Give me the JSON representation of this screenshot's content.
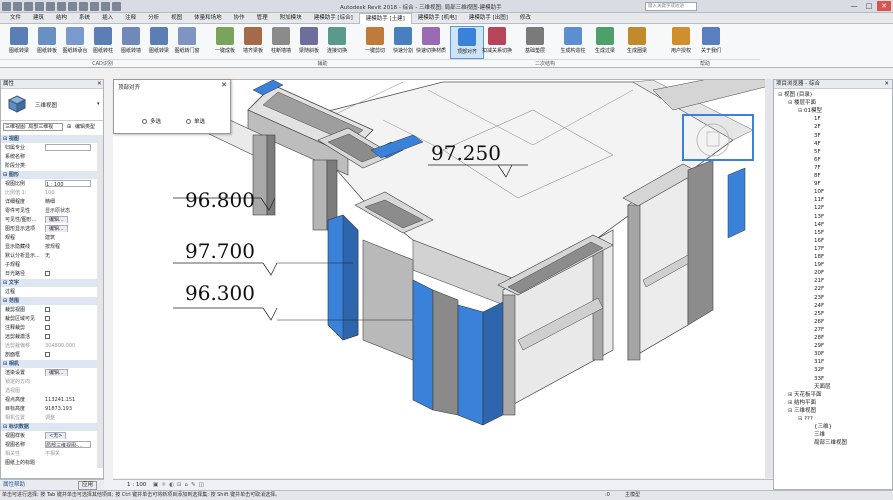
{
  "app": {
    "title": "Autodesk Revit 2018 -    综合 - 三维视图: 局部三维视图-建模助手",
    "search_placeholder": "键入关键字或短语",
    "min": "—",
    "max": "□",
    "close": "✕"
  },
  "menu_tabs": [
    "文件",
    "建筑",
    "结构",
    "系统",
    "插入",
    "注释",
    "分析",
    "视图",
    "体量和场地",
    "协作",
    "管理",
    "附加模块",
    "建模助手 [综合]",
    "建模助手 [土建]",
    "建模助手 [机电]",
    "建模助手 [出图]",
    "修改"
  ],
  "menu_active_index": 13,
  "ribbon": {
    "buttons": [
      "图纸转梁",
      "图纸转板",
      "图纸转承台",
      "图纸转柱",
      "图纸转墙",
      "图纸转梁",
      "图纸转门窗",
      "一键成板",
      "墙齐梁板",
      "柱断墙墙",
      "梁随斜板",
      "连接切换",
      "一键剪切",
      "快速分割",
      "快速切换材质",
      "顶部对齐",
      "扣减关系切换",
      "基础垫层",
      "生成构造柱",
      "生成过梁",
      "生成圈梁",
      "用户授权",
      "关于我们"
    ],
    "selected_index": 15,
    "groups": [
      "CAD识别",
      "辅助",
      "二次结构",
      "帮助"
    ]
  },
  "properties": {
    "header": "属性",
    "type_name": "三维视图",
    "view_selector": "三维视图: 局部三维视",
    "edit_type": "编辑类型",
    "rows": [
      {
        "k": "视图",
        "v": "",
        "kind": "section"
      },
      {
        "k": "归属专业",
        "v": "",
        "kind": "field"
      },
      {
        "k": "系统名称",
        "v": "",
        "kind": "text"
      },
      {
        "k": "阶段分类",
        "v": "",
        "kind": "text"
      },
      {
        "k": "图形",
        "v": "",
        "kind": "section"
      },
      {
        "k": "视图比例",
        "v": "1 : 100",
        "kind": "field"
      },
      {
        "k": "比例值 1:",
        "v": "100",
        "kind": "grey"
      },
      {
        "k": "详细程度",
        "v": "精细",
        "kind": "text"
      },
      {
        "k": "零件可见性",
        "v": "显示原状态",
        "kind": "text"
      },
      {
        "k": "可见性/图形...",
        "v": "编辑...",
        "kind": "button"
      },
      {
        "k": "图形显示选项",
        "v": "编辑...",
        "kind": "button"
      },
      {
        "k": "规程",
        "v": "建筑",
        "kind": "text"
      },
      {
        "k": "显示隐藏线",
        "v": "按规程",
        "kind": "text"
      },
      {
        "k": "默认分析显示...",
        "v": "无",
        "kind": "text"
      },
      {
        "k": "子规程",
        "v": "",
        "kind": "text"
      },
      {
        "k": "日光路径",
        "v": "",
        "kind": "check"
      },
      {
        "k": "文字",
        "v": "",
        "kind": "section"
      },
      {
        "k": "过程",
        "v": "",
        "kind": "text"
      },
      {
        "k": "范围",
        "v": "",
        "kind": "section"
      },
      {
        "k": "裁剪视图",
        "v": "",
        "kind": "check"
      },
      {
        "k": "裁剪区域可见",
        "v": "",
        "kind": "check"
      },
      {
        "k": "注释裁剪",
        "v": "",
        "kind": "check"
      },
      {
        "k": "远剪裁激活",
        "v": "",
        "kind": "check"
      },
      {
        "k": "远剪裁偏移",
        "v": "304800.000",
        "kind": "grey"
      },
      {
        "k": "剖面框",
        "v": "",
        "kind": "check"
      },
      {
        "k": "相机",
        "v": "",
        "kind": "section"
      },
      {
        "k": "渲染设置",
        "v": "编辑...",
        "kind": "button"
      },
      {
        "k": "锁定的方向",
        "v": "",
        "kind": "grey"
      },
      {
        "k": "透视图",
        "v": "",
        "kind": "grey"
      },
      {
        "k": "视点高度",
        "v": "113241.151",
        "kind": "text"
      },
      {
        "k": "目标高度",
        "v": "91873.193",
        "kind": "text"
      },
      {
        "k": "相机位置",
        "v": "调整",
        "kind": "grey"
      },
      {
        "k": "标识数据",
        "v": "",
        "kind": "section"
      },
      {
        "k": "视图样板",
        "v": "<无>",
        "kind": "button"
      },
      {
        "k": "视图名称",
        "v": "局部三维视图-...",
        "kind": "field"
      },
      {
        "k": "相关性",
        "v": "不相关",
        "kind": "grey"
      },
      {
        "k": "图纸上的标题",
        "v": "",
        "kind": "text"
      }
    ],
    "help_link": "属性帮助",
    "apply": "应用"
  },
  "popup": {
    "title": "顶部对齐",
    "close": "✕",
    "option_a": "多选",
    "option_b": "单选"
  },
  "labels": [
    "97.250",
    "96.800",
    "97.700",
    "96.300"
  ],
  "project_browser": {
    "header": "项目浏览器 - 综合",
    "items": [
      {
        "t": "视图 (目录)",
        "lvl": 0,
        "tg": "⊟"
      },
      {
        "t": "楼层平面",
        "lvl": 1,
        "tg": "⊟"
      },
      {
        "t": "01模型",
        "lvl": 2,
        "tg": "⊟"
      },
      {
        "t": "1F",
        "lvl": 3
      },
      {
        "t": "2F",
        "lvl": 3
      },
      {
        "t": "3F",
        "lvl": 3
      },
      {
        "t": "4F",
        "lvl": 3
      },
      {
        "t": "5F",
        "lvl": 3
      },
      {
        "t": "6F",
        "lvl": 3
      },
      {
        "t": "7F",
        "lvl": 3
      },
      {
        "t": "8F",
        "lvl": 3
      },
      {
        "t": "9F",
        "lvl": 3
      },
      {
        "t": "10F",
        "lvl": 3
      },
      {
        "t": "11F",
        "lvl": 3
      },
      {
        "t": "12F",
        "lvl": 3
      },
      {
        "t": "13F",
        "lvl": 3
      },
      {
        "t": "14F",
        "lvl": 3
      },
      {
        "t": "15F",
        "lvl": 3
      },
      {
        "t": "16F",
        "lvl": 3
      },
      {
        "t": "17F",
        "lvl": 3
      },
      {
        "t": "18F",
        "lvl": 3
      },
      {
        "t": "19F",
        "lvl": 3
      },
      {
        "t": "20F",
        "lvl": 3
      },
      {
        "t": "21F",
        "lvl": 3
      },
      {
        "t": "22F",
        "lvl": 3
      },
      {
        "t": "23F",
        "lvl": 3
      },
      {
        "t": "24F",
        "lvl": 3
      },
      {
        "t": "25F",
        "lvl": 3
      },
      {
        "t": "26F",
        "lvl": 3
      },
      {
        "t": "27F",
        "lvl": 3
      },
      {
        "t": "28F",
        "lvl": 3
      },
      {
        "t": "29F",
        "lvl": 3
      },
      {
        "t": "30F",
        "lvl": 3
      },
      {
        "t": "31F",
        "lvl": 3
      },
      {
        "t": "32F",
        "lvl": 3
      },
      {
        "t": "33F",
        "lvl": 3
      },
      {
        "t": "天面层",
        "lvl": 3
      },
      {
        "t": "天花板平面",
        "lvl": 1,
        "tg": "⊞"
      },
      {
        "t": "结构平面",
        "lvl": 1,
        "tg": "⊞"
      },
      {
        "t": "三维视图",
        "lvl": 1,
        "tg": "⊟"
      },
      {
        "t": "???",
        "lvl": 2,
        "tg": "⊟"
      },
      {
        "t": "{三维}",
        "lvl": 3
      },
      {
        "t": "三维",
        "lvl": 3
      },
      {
        "t": "局部三维视图",
        "lvl": 3
      }
    ]
  },
  "viewbar": {
    "scale": "1 : 100"
  },
  "statusbar": {
    "hint": "单击可进行选择; 按 Tab 键并单击可选择其他项目; 按 Ctrl 键并单击可将新项目添加到选择集; 按 Shift 键并单击可取消选择。",
    "zero": ":0",
    "model": "主模型"
  },
  "colors": {
    "accent": "#2e7fd6",
    "concrete": "#c8c8c8",
    "blue_face": "#3a82d9"
  }
}
